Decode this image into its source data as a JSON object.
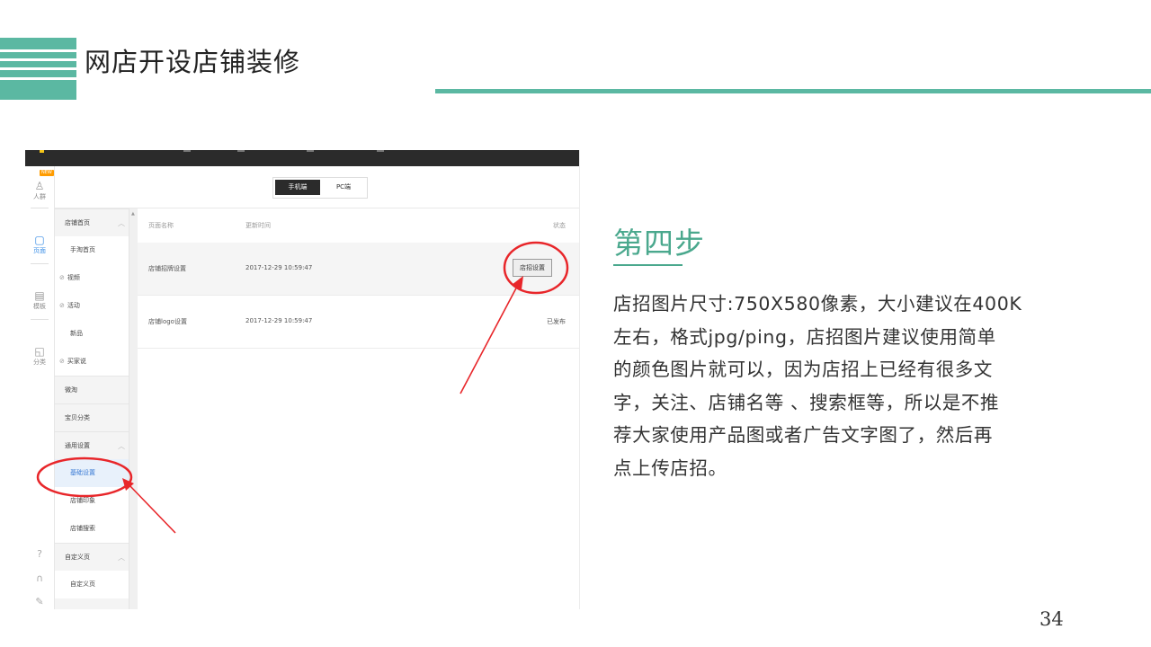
{
  "slide": {
    "title": "网店开设店铺装修",
    "page_number": "34",
    "accent_color": "#5bb8a2"
  },
  "screenshot": {
    "left_rail": {
      "badge": "NEW",
      "items": [
        {
          "label": "人群",
          "icon": "user-icon",
          "active": false
        },
        {
          "label": "页面",
          "icon": "page-icon",
          "active": true
        },
        {
          "label": "模板",
          "icon": "template-icon",
          "active": false
        },
        {
          "label": "分类",
          "icon": "category-icon",
          "active": false
        }
      ],
      "footer_icons": [
        "help-icon",
        "headset-icon",
        "edit-icon"
      ]
    },
    "toggle": {
      "mobile": "手机端",
      "pc": "PC端",
      "selected": "手机端"
    },
    "menu": {
      "group_shop_home": "店铺首页",
      "item_mobile_taobao_home": "手淘首页",
      "item_video": "视频",
      "item_activity": "活动",
      "item_new": "新品",
      "item_buyer_says": "买家说",
      "group_weitao": "微淘",
      "group_category": "宝贝分类",
      "group_general": "通用设置",
      "item_basic_settings": "基础设置",
      "item_shop_impression": "店铺印象",
      "item_shop_search": "店铺搜索",
      "group_custom_page": "自定义页",
      "item_custom_page": "自定义页"
    },
    "table": {
      "headers": {
        "name": "页面名称",
        "updated": "更新时间",
        "status": "状态"
      },
      "rows": [
        {
          "name": "店铺招牌设置",
          "updated": "2017-12-29 10:59:47",
          "action": "店招设置"
        },
        {
          "name": "店铺logo设置",
          "updated": "2017-12-29 10:59:47",
          "status": "已发布"
        }
      ]
    },
    "annotation_color": "#e8262a"
  },
  "step": {
    "title": "第四步",
    "lines": [
      "店招图片尺寸:750X580像素，大小建议在400K",
      "左右，格式jpg/ping，店招图片建议使用简单",
      "的颜色图片就可以，因为店招上已经有很多文",
      "字，关注、店铺名等 、搜索框等，所以是不推",
      "荐大家使用产品图或者广告文字图了，然后再",
      "点上传店招。"
    ]
  }
}
